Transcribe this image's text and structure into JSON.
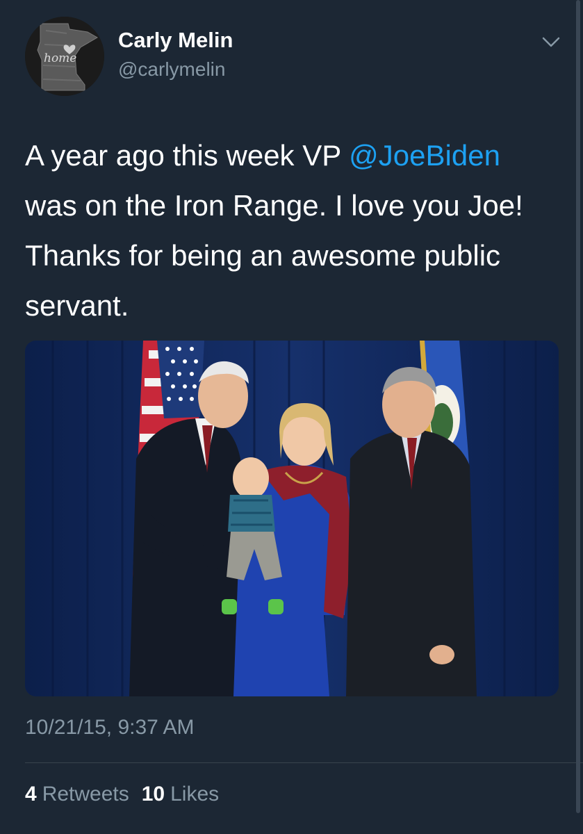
{
  "author": {
    "name": "Carly Melin",
    "handle": "@carlymelin",
    "avatar_word": "home"
  },
  "tweet": {
    "line1_before": "A year ago this week VP ",
    "mention": "@JoeBiden",
    "line2": "was on the Iron Range. I love you Joe!",
    "line3": "Thanks for being an awesome public",
    "line4": "servant."
  },
  "timestamp": "10/21/15, 9:37 AM",
  "stats": {
    "retweets_count": "4",
    "retweets_label": "Retweets",
    "likes_count": "10",
    "likes_label": "Likes"
  },
  "colors": {
    "background": "#1c2734",
    "link": "#1da1f2",
    "secondary_text": "#8899a6",
    "divider": "#38444d"
  },
  "icons": {
    "menu": "chevron-down-icon"
  }
}
